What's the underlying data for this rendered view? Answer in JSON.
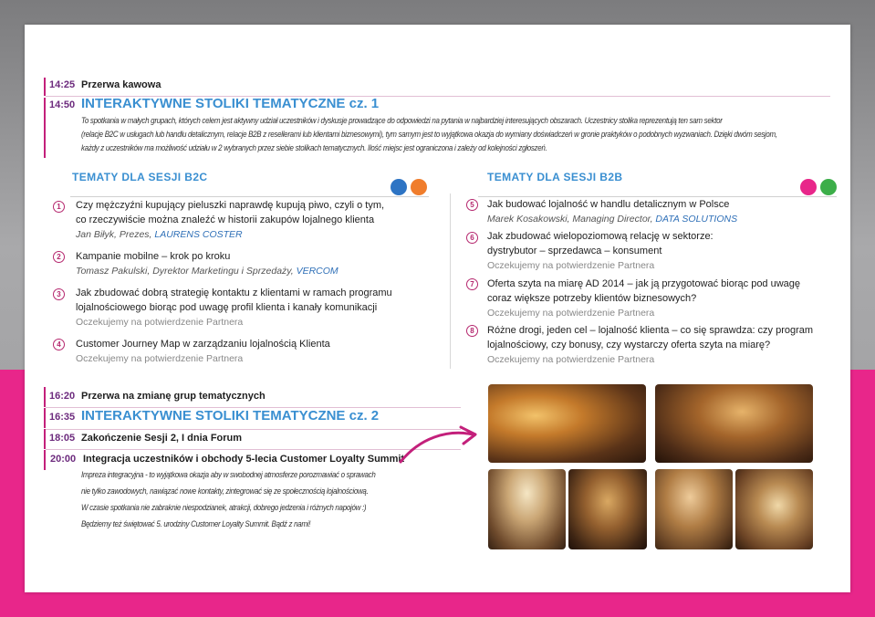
{
  "schedule_top": [
    {
      "time": "14:25",
      "label": "Przerwa kawowa"
    },
    {
      "time": "14:50",
      "label": "INTERAKTYWNE STOLIKI TEMATYCZNE cz. 1"
    }
  ],
  "description_lines": [
    "To spotkania w małych grupach, których celem jest aktywny udział uczestników i dyskusje prowadzące do odpowiedzi na pytania w najbardziej interesujących obszarach. Uczestnicy stolika reprezentują ten sam sektor",
    "(relacje B2C w usługach lub handlu detalicznym, relacje B2B z resellerami lub klientami biznesowymi), tym samym jest to wyjątkowa okazja do wymiany doświadczeń w gronie praktyków o podobnych wyzwaniach. Dzięki dwóm sesjom,",
    "każdy z uczestników ma możliwość udziału w 2 wybranych przez siebie stolikach tematycznych. Ilość miejsc jest ograniczona i zależy od kolejności zgłoszeń."
  ],
  "b2c": {
    "header": "TEMATY DLA SESJI B2C",
    "items": [
      {
        "num": "1",
        "lines": [
          "Czy mężczyźni kupujący pieluszki naprawdę kupują piwo, czyli o tym,",
          "co rzeczywiście można znaleźć w historii zakupów lojalnego klienta"
        ],
        "speaker": "Jan Biłyk, Prezes,",
        "company": "LAURENS COSTER"
      },
      {
        "num": "2",
        "lines": [
          "Kampanie mobilne – krok po kroku"
        ],
        "speaker": "Tomasz Pakulski,  Dyrektor Marketingu i Sprzedaży,",
        "company": "VERCOM"
      },
      {
        "num": "3",
        "lines": [
          "Jak zbudować dobrą strategię kontaktu z klientami w ramach programu",
          "lojalnościowego biorąc pod uwagę profil klienta i kanały komunikacji"
        ],
        "await": "Oczekujemy na potwierdzenie Partnera"
      },
      {
        "num": "4",
        "lines": [
          "Customer Journey Map w zarządzaniu lojalnością Klienta"
        ],
        "await": "Oczekujemy na potwierdzenie Partnera"
      }
    ]
  },
  "b2b": {
    "header": "TEMATY DLA SESJI B2B",
    "items": [
      {
        "num": "5",
        "lines": [
          "Jak budować lojalność w handlu detalicznym w Polsce"
        ],
        "speaker": "Marek Kosakowski, Managing Director,",
        "company": "DATA SOLUTIONS"
      },
      {
        "num": "6",
        "lines": [
          "Jak zbudować wielopoziomową relację w sektorze:",
          "dystrybutor – sprzedawca – konsument"
        ],
        "await": "Oczekujemy na potwierdzenie Partnera"
      },
      {
        "num": "7",
        "lines": [
          "Oferta szyta na miarę AD 2014 – jak ją przygotować biorąc pod uwagę",
          "coraz większe potrzeby klientów biznesowych?"
        ],
        "await": "Oczekujemy na potwierdzenie Partnera"
      },
      {
        "num": "8",
        "lines": [
          "Różne drogi, jeden cel – lojalność klienta – co się sprawdza: czy program",
          "lojalnościowy, czy bonusy, czy wystarczy oferta szyta na miarę?"
        ],
        "await": "Oczekujemy na potwierdzenie Partnera"
      }
    ]
  },
  "schedule_bottom": [
    {
      "time": "16:20",
      "label": "Przerwa na zmianę grup tematycznych"
    },
    {
      "time": "16:35",
      "label": "INTERAKTYWNE STOLIKI TEMATYCZNE cz. 2"
    },
    {
      "time": "18:05",
      "label": "Zakończenie Sesji 2, I dnia Forum"
    },
    {
      "time": "20:00",
      "label": "Integracja uczestników i obchody 5-lecia Customer Loyalty Summit"
    }
  ],
  "party_lines": [
    "Impreza integracyjna - to wyjątkowa okazja aby w swobodnej atmosferze porozmawiać o sprawach",
    "nie tylko zawodowych, nawiązać nowe kontakty, zintegrować się ze społecznością lojalnościową.",
    "W czasie spotkania nie zabraknie niespodzianek, atrakcji, dobrego jedzenia i różnych napojów :)",
    "Będziemy też świętować 5. urodziny Customer Loyalty Summit. Bądź z nami!"
  ],
  "colors": {
    "accent_pink": "#e8268a",
    "accent_blue": "#3a8fd1",
    "time_purple": "#6c2a7d",
    "dot_blue": "#2d74c4",
    "dot_orange": "#f07d2c",
    "dot_pink": "#e8268a",
    "dot_green": "#3cae49"
  },
  "icons": [
    "pink-arrow-icon"
  ],
  "photos": [
    "event-photo-1",
    "event-photo-2",
    "event-photo-3",
    "event-photo-4",
    "event-photo-5",
    "event-photo-6"
  ]
}
